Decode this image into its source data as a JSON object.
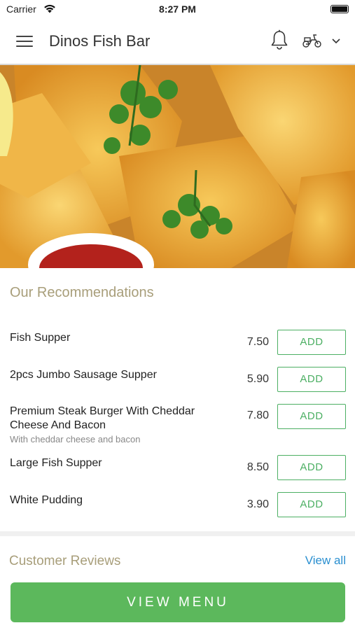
{
  "status_bar": {
    "carrier": "Carrier",
    "time": "8:27 PM"
  },
  "header": {
    "title": "Dinos Fish Bar"
  },
  "icons": {
    "menu": "hamburger-menu-icon",
    "notifications": "bell-icon",
    "delivery": "scooter-icon",
    "dropdown": "chevron-down-icon"
  },
  "recommendations": {
    "title": "Our Recommendations",
    "add_label": "ADD",
    "items": [
      {
        "name": "Fish Supper",
        "description": "",
        "price": "7.50"
      },
      {
        "name": "2pcs Jumbo Sausage Supper",
        "description": "",
        "price": "5.90"
      },
      {
        "name": "Premium Steak Burger With Cheddar Cheese And Bacon",
        "description": "With cheddar cheese and bacon",
        "price": "7.80"
      },
      {
        "name": "Large Fish Supper",
        "description": "",
        "price": "8.50"
      },
      {
        "name": "White Pudding",
        "description": "",
        "price": "3.90"
      }
    ]
  },
  "reviews": {
    "title": "Customer Reviews",
    "view_all": "View all"
  },
  "cta": {
    "label": "VIEW MENU"
  },
  "colors": {
    "accent_green": "#5cb85c",
    "section_title": "#a89e7a",
    "link_blue": "#2a8fd0"
  }
}
